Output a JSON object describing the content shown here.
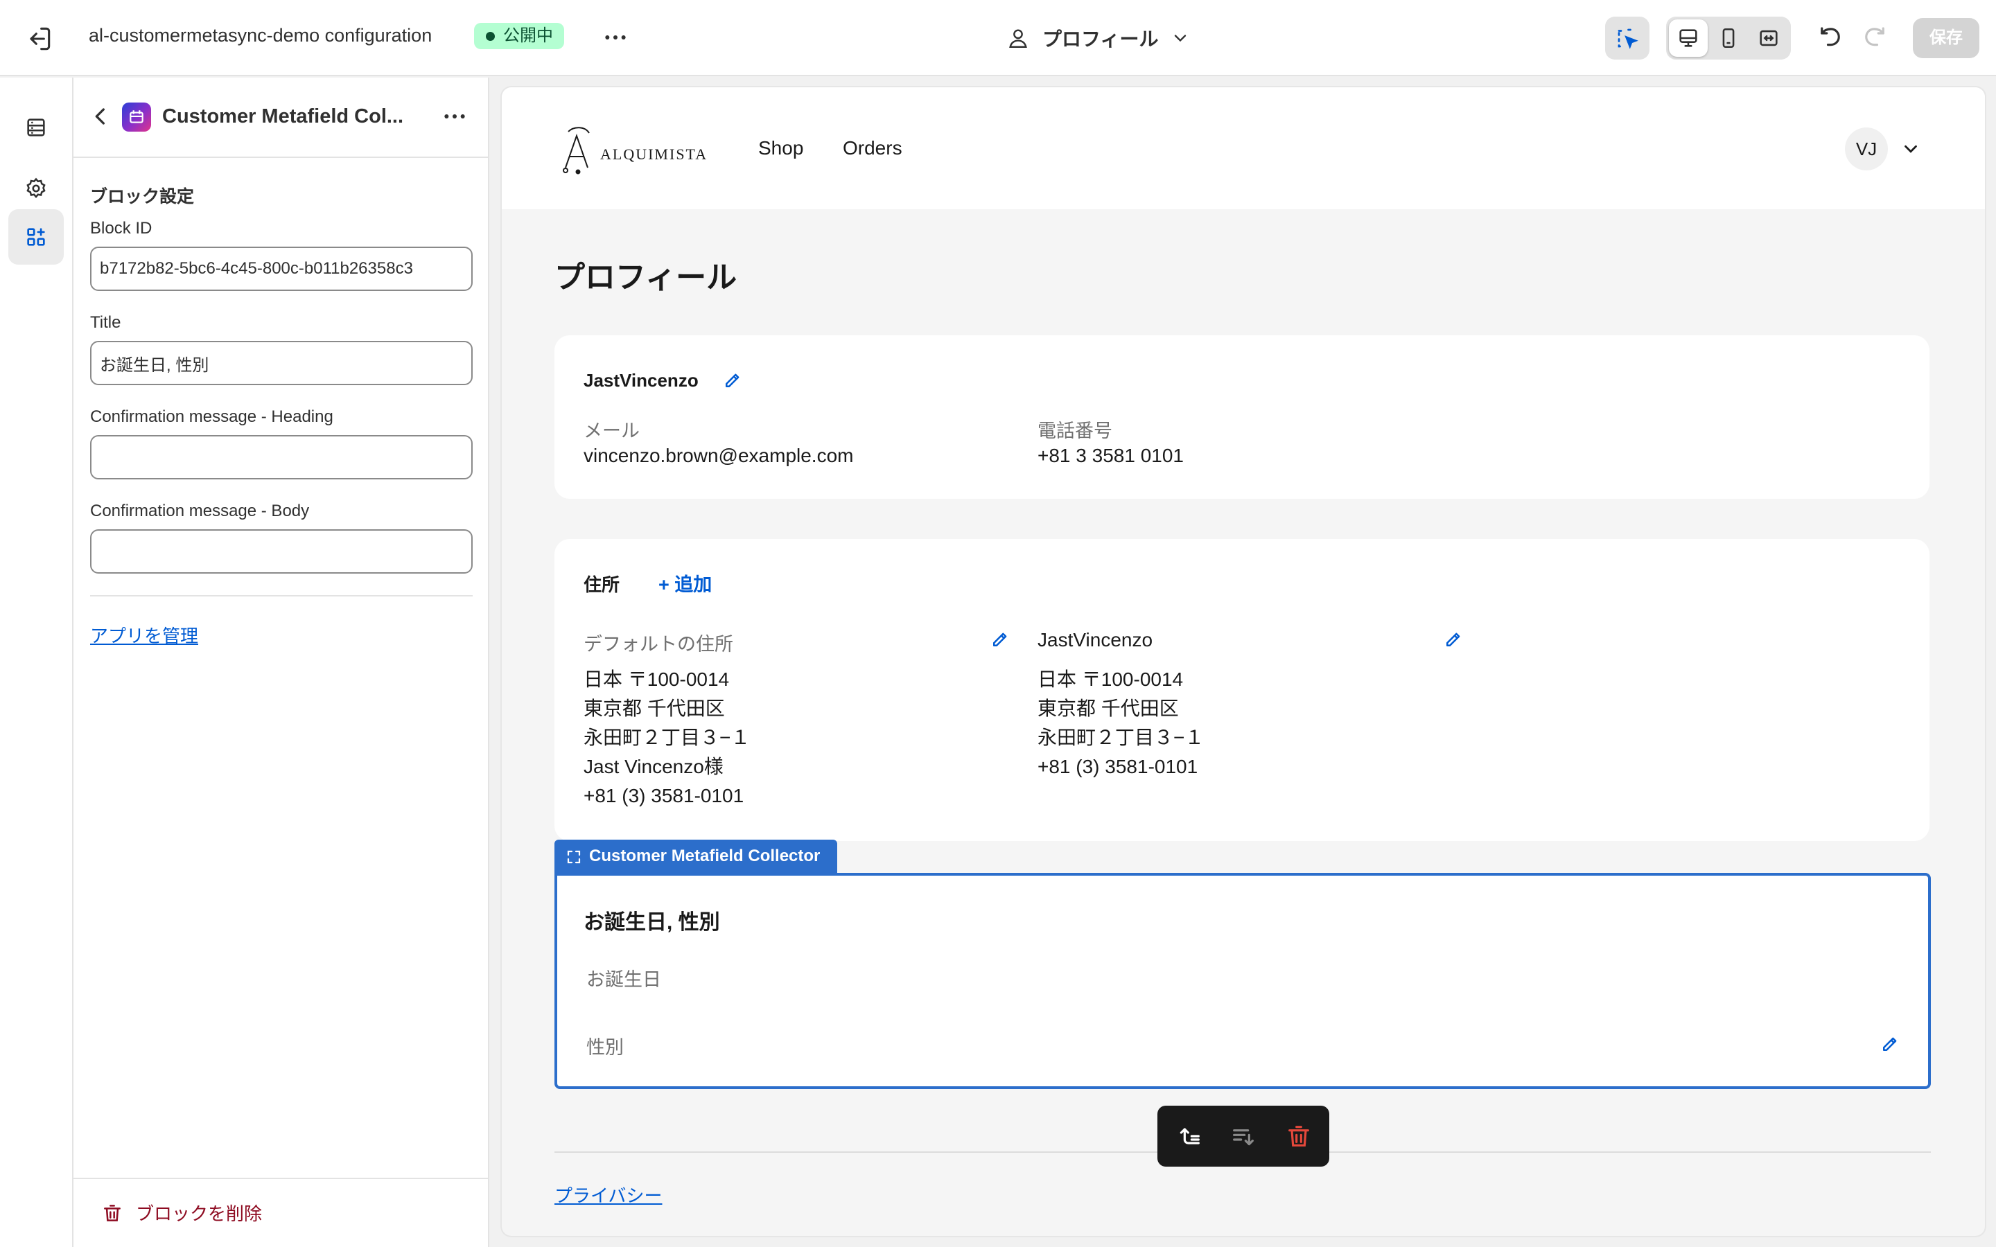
{
  "topbar": {
    "title": "al-customermetasync-demo configuration",
    "status_badge": "公開中",
    "page_selector": "プロフィール",
    "save_label": "保存"
  },
  "panel": {
    "title": "Customer Metafield Col...",
    "section_title": "ブロック設定",
    "fields": {
      "block_id": {
        "label": "Block ID",
        "value": "b7172b82-5bc6-4c45-800c-b011b26358c3"
      },
      "title": {
        "label": "Title",
        "value": "お誕生日, 性別"
      },
      "confirm_heading": {
        "label": "Confirmation message - Heading",
        "value": ""
      },
      "confirm_body": {
        "label": "Confirmation message - Body",
        "value": ""
      }
    },
    "manage_app_link": "アプリを管理",
    "delete_label": "ブロックを削除"
  },
  "store": {
    "brand": "ALQUIMISTA",
    "nav": [
      "Shop",
      "Orders"
    ],
    "avatar_initials": "VJ",
    "page_title": "プロフィール",
    "profile": {
      "name": "JastVincenzo",
      "email_label": "メール",
      "email": "vincenzo.brown@example.com",
      "phone_label": "電話番号",
      "phone": "+81 3 3581 0101"
    },
    "addresses": {
      "title": "住所",
      "add_label": "+ 追加",
      "default_label": "デフォルトの住所",
      "default_lines": [
        "日本 〒100-0014",
        "東京都 千代田区",
        "永田町２丁目３−１",
        "Jast Vincenzo様",
        "+81 (3) 3581-0101"
      ],
      "second_name": "JastVincenzo",
      "second_lines": [
        "日本 〒100-0014",
        "東京都 千代田区",
        "永田町２丁目３−１",
        "+81 (3) 3581-0101"
      ]
    },
    "block": {
      "tag": "Customer Metafield Collector",
      "title": "お誕生日, 性別",
      "field_birthday": "お誕生日",
      "field_gender": "性別"
    },
    "privacy_link": "プライバシー"
  },
  "colors": {
    "accent": "#005bd3",
    "block_outline": "#2c6ecb",
    "badge_bg": "#b4fed2",
    "danger": "#8e0b21"
  }
}
